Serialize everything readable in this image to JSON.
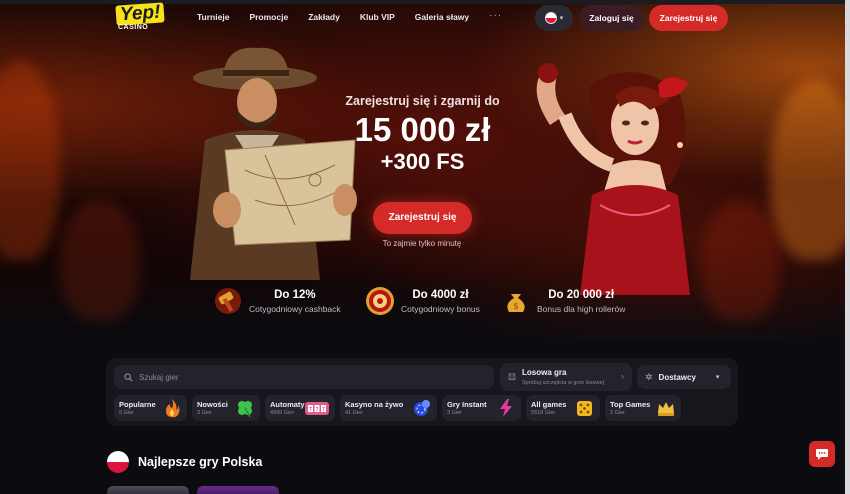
{
  "header": {
    "logo_main": "Yep!",
    "logo_sub": "CASINO",
    "nav": [
      "Turnieje",
      "Promocje",
      "Zakłady",
      "Klub VIP",
      "Galeria sławy"
    ],
    "nav_more": "···",
    "login": "Zaloguj się",
    "register": "Zarejestruj się"
  },
  "hero": {
    "subtitle": "Zarejestruj się i zgarnij do",
    "amount": "15 000 zł",
    "free_spins": "+300 FS",
    "cta": "Zarejestruj się",
    "note": "To zajmie tylko minutę"
  },
  "benefits": [
    {
      "title": "Do 12%",
      "desc": "Cotygodniowy cashback",
      "icon": "hammer-icon"
    },
    {
      "title": "Do 4000 zł",
      "desc": "Cotygodniowy bonus",
      "icon": "dartboard-icon"
    },
    {
      "title": "Do 20 000 zł",
      "desc": "Bonus dla high rollerów",
      "icon": "money-bag-icon"
    }
  ],
  "gamebar": {
    "search_placeholder": "Szukaj gier",
    "random_title": "Losowa gra",
    "random_sub": "Spróbuj szczęścia w grze losowej",
    "providers": "Dostawcy",
    "categories": [
      {
        "name": "Popularne",
        "count": "5 Gier",
        "icon": "fire-icon"
      },
      {
        "name": "Nowości",
        "count": "3 Gier",
        "icon": "clover-icon"
      },
      {
        "name": "Automaty",
        "count": "4999 Gier",
        "icon": "slot-machine-icon"
      },
      {
        "name": "Kasyno na żywo",
        "count": "41 Gier",
        "icon": "poker-chips-icon"
      },
      {
        "name": "Gry Instant",
        "count": "3 Gier",
        "icon": "lightning-icon"
      },
      {
        "name": "All games",
        "count": "5518 Gier",
        "icon": "dice-icon"
      },
      {
        "name": "Top Games",
        "count": "2 Gier",
        "icon": "crown-icon"
      }
    ]
  },
  "section": {
    "title": "Najlepsze gry Polska"
  },
  "colors": {
    "accent": "#d42b28",
    "background": "#0b0b10",
    "panel": "#16161d"
  }
}
